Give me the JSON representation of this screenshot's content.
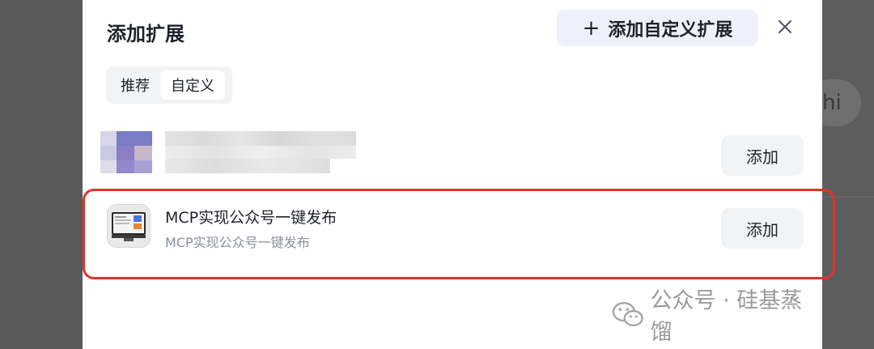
{
  "dialog": {
    "title": "添加扩展",
    "custom_button_label": "添加自定义扩展",
    "tabs": [
      {
        "label": "推荐",
        "active": false
      },
      {
        "label": "自定义",
        "active": true
      }
    ]
  },
  "extensions": [
    {
      "title": "",
      "description": "",
      "add_label": "添加",
      "blurred": true
    },
    {
      "title": "MCP实现公众号一键发布",
      "description": "MCP实现公众号一键发布",
      "add_label": "添加",
      "highlighted": true
    }
  ],
  "watermark": {
    "text": "公众号 · 硅基蒸馏"
  },
  "background": {
    "avatar_text": "hi"
  },
  "colors": {
    "highlight": "#e0352b",
    "button_bg": "#f2f3f5",
    "custom_button_bg": "#eef0fb",
    "overlay": "#5a5a5a"
  }
}
